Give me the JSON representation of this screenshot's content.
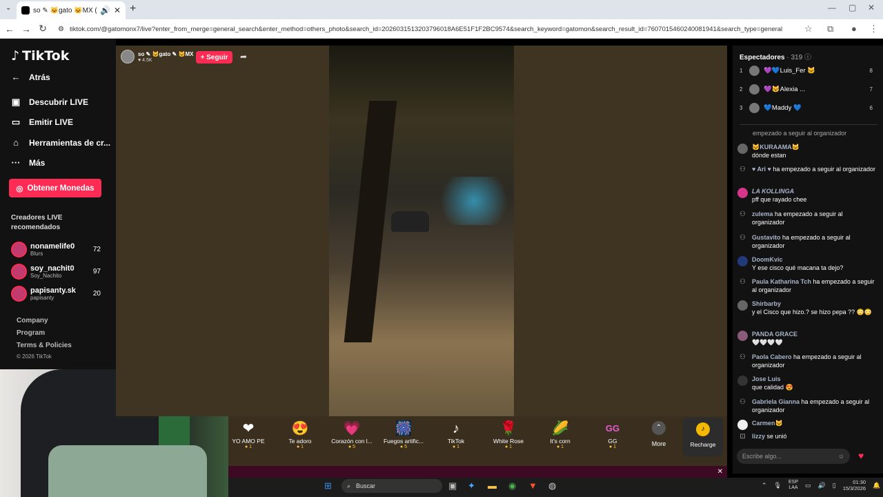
{
  "browser": {
    "tab_title": "so ✎ 🐱gato 🐱MX (@g...",
    "url": "tiktok.com/@gatomonx7/live?enter_from_merge=general_search&enter_method=others_photo&search_id=20260315132037960​18A6E51F1F2BC9574&search_keyword=gatomon&search_result_id=7607015460240081941&search_type=general"
  },
  "sidebar": {
    "logo": "TikTok",
    "back": "Atrás",
    "items": [
      {
        "label": "Descubrir LIVE",
        "icon": "live-tv-icon"
      },
      {
        "label": "Emitir LIVE",
        "icon": "video-camera-icon"
      },
      {
        "label": "Herramientas de cr...",
        "icon": "lightbulb-icon"
      },
      {
        "label": "Más",
        "icon": "more-dots-icon"
      }
    ],
    "coins_button": "Obtener Monedas",
    "reco_title": "Creadores LIVE recomendados",
    "creators": [
      {
        "name": "nonamelife0",
        "sub": "Blurs",
        "count": "72"
      },
      {
        "name": "soy_nachit0",
        "sub": "Soy_Nachito",
        "count": "97"
      },
      {
        "name": "papisanty.sk",
        "sub": "papisanty",
        "count": "20"
      }
    ],
    "footer": [
      "Company",
      "Program",
      "Terms & Policies"
    ],
    "copyright": "© 2026 TikTok"
  },
  "host": {
    "name": "so ✎ 🐱gato ✎ 🐱MX",
    "likes": "♥ 4.5K",
    "follow": "+ Seguir"
  },
  "gifts": [
    {
      "name": "YO AMO PE",
      "price": "1",
      "icon": "❤"
    },
    {
      "name": "Te adoro",
      "price": "1",
      "icon": "😍"
    },
    {
      "name": "Corazón con l...",
      "price": "5",
      "icon": "💗"
    },
    {
      "name": "Fuegos artific...",
      "price": "5",
      "icon": "🎆"
    },
    {
      "name": "TikTok",
      "price": "1",
      "icon": "♪"
    },
    {
      "name": "White Rose",
      "price": "1",
      "icon": "🌹"
    },
    {
      "name": "It's corn",
      "price": "1",
      "icon": "🌽"
    },
    {
      "name": "GG",
      "price": "1",
      "icon": "GG"
    }
  ],
  "more_label": "More",
  "recharge_label": "Recharge",
  "chat": {
    "spectators_label": "Espectadores",
    "spectators_count": "· 319",
    "viewers": [
      {
        "rank": "1",
        "name": "💜💙Luis_Fer 🐱",
        "score": "8"
      },
      {
        "rank": "2",
        "name": "💜🐱Alexia ...",
        "score": "7"
      },
      {
        "rank": "3",
        "name": "💙Maddy 💙",
        "score": "6"
      }
    ],
    "top_system": "empezado a seguir al organizador",
    "messages": [
      {
        "user": "🐱KURAAMA🐱",
        "text": "dónde estan",
        "sys": false
      },
      {
        "user": "♥ Ari ♥",
        "text": "ha empezado a seguir al organizador",
        "sys": true
      },
      {
        "user": "LA KOLLINGA",
        "text": "pff que rayado chee",
        "sys": false
      },
      {
        "user": "zulema",
        "text": "ha empezado a seguir al organizador",
        "sys": true
      },
      {
        "user": "Gustavito",
        "text": "ha empezado a seguir al organizador",
        "sys": true
      },
      {
        "user": "DoomKvic",
        "text": "Y ese cisco qué macana ta dejo?",
        "sys": false
      },
      {
        "user": "Paula Katharina Tch",
        "text": "ha empezado a seguir al organizador",
        "sys": true
      },
      {
        "user": "Shirbarby",
        "text": "y el Cisco que hizo.? se hizo pepa ?? 😳😳",
        "sys": false
      },
      {
        "user": "PANDA GRACE",
        "text": "🤍🤍🤍🤍",
        "sys": false
      },
      {
        "user": "Paola Cabero",
        "text": "ha empezado a seguir al organizador",
        "sys": true
      },
      {
        "user": "Jose Luis",
        "text": "que calidad 😍",
        "sys": false
      },
      {
        "user": "Gabriela Gianna",
        "text": "ha empezado a seguir al organizador",
        "sys": true
      },
      {
        "user": "Carmen🐱",
        "text": "",
        "sys": false
      },
      {
        "user": "lizzy",
        "text": "se unió",
        "sys": true
      }
    ],
    "input_placeholder": "Escribe algo..."
  },
  "taskbar": {
    "search": "Buscar",
    "lang": "ESP\nLAA",
    "time": "01:30",
    "date": "15/3/2026"
  }
}
